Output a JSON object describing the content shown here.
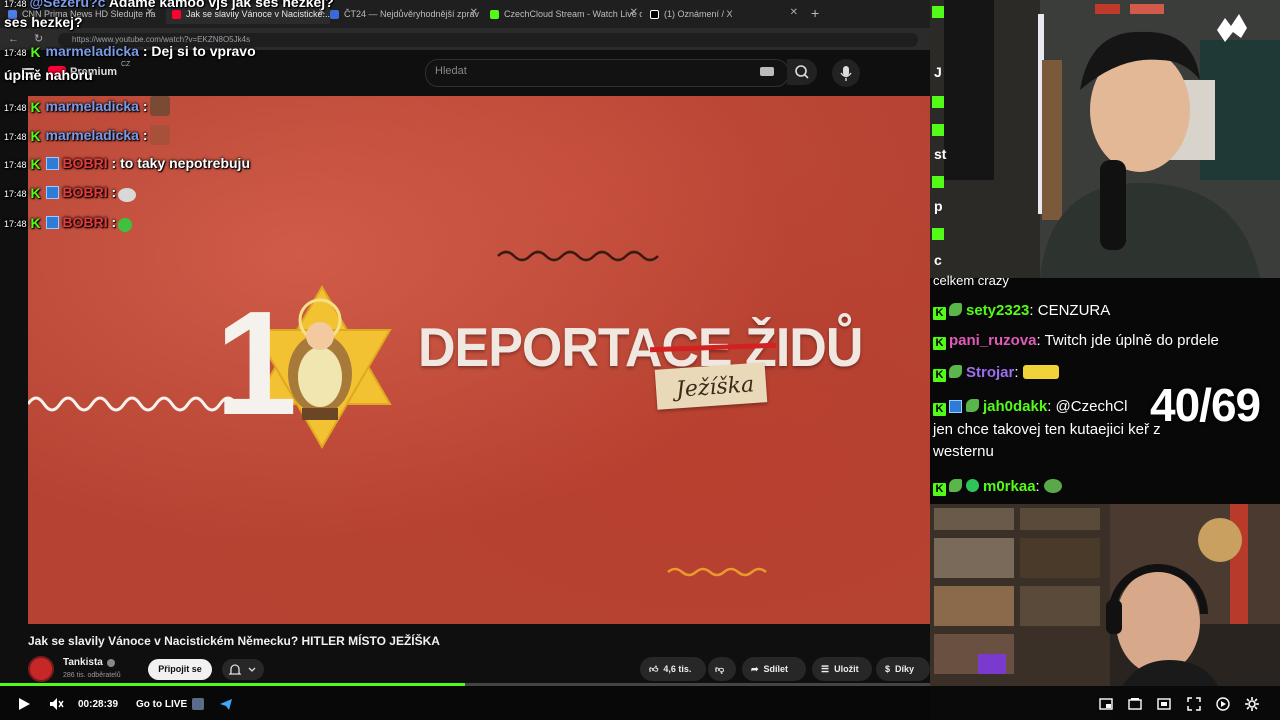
{
  "browser": {
    "tabs": [
      {
        "label": "CNN Prima News HD Sledujte na",
        "active": false,
        "color": "#4d7ee8"
      },
      {
        "label": "Jak se slavily Vánoce v Nacistické...",
        "active": true,
        "color": "#ff0033"
      },
      {
        "label": "ČT24 — Nejdůvěryhodnější zprav",
        "active": false,
        "color": "#3a6ad6"
      },
      {
        "label": "CzechCloud Stream - Watch Live o",
        "active": false,
        "color": "#53fc18"
      },
      {
        "label": "(1) Oznámení / X",
        "active": false,
        "color": "#ffffff"
      }
    ],
    "new_tab": "+",
    "url": "https://www.youtube.com/watch?v=EKZN8O5Jk4s"
  },
  "youtube": {
    "logo": "Premium",
    "logo_region": "CZ",
    "search_placeholder": "Hledat",
    "video": {
      "thumb_number": "1",
      "thumb_title": "DEPORTACE ŽIDŮ",
      "thumb_tag": "Ježíška",
      "title": "Jak se slavily Vánoce v Nacistickém Německu? HITLER MÍSTO JEŽÍŠKA"
    },
    "channel": {
      "name": "Tankista",
      "subscribers": "286 tis. odběratelů"
    },
    "subscribe_label": "Připojit se",
    "actions": {
      "likes": "4,6 tis.",
      "share": "Sdílet",
      "save": "Uložit",
      "thanks": "Díky"
    }
  },
  "left_chat": [
    {
      "time": "17:48",
      "user": "@Sezeru?c",
      "text": "Adame kamoo vjs jak ses hezkej?",
      "partial": true
    },
    {
      "time": "17:48",
      "user": "marmeladicka",
      "text": ": Dej si to vpravo",
      "wrap": "úplně nahoru",
      "badges": [
        "k"
      ]
    },
    {
      "time": "17:48",
      "user": "marmeladicka",
      "text": ":",
      "emote": "face",
      "badges": [
        "k"
      ]
    },
    {
      "time": "17:48",
      "user": "marmeladicka",
      "text": ":",
      "emote": "face2",
      "badges": [
        "k"
      ]
    },
    {
      "time": "17:48",
      "user": "BOBRI",
      "text": ": to taky nepotrebuju",
      "badges": [
        "k",
        "s"
      ]
    },
    {
      "time": "17:48",
      "user": "BOBRI",
      "text": ":",
      "emote": "troll",
      "badges": [
        "k",
        "s"
      ]
    },
    {
      "time": "17:48",
      "user": "BOBRI",
      "text": ":",
      "emote": "green",
      "badges": [
        "k",
        "s"
      ]
    }
  ],
  "right_chat": [
    {
      "user": "",
      "text": "celkem crazy"
    },
    {
      "user": "sety2323",
      "text": ": CENZURA",
      "color": "#53fc18"
    },
    {
      "user": "pani_ruzova",
      "text": ": Twitch jde úplně do prdele",
      "color": "#e05ab8"
    },
    {
      "user": "Strojar",
      "text": ":",
      "color": "#9b6ef0"
    },
    {
      "user": "jah0dakk",
      "text": ": @CzechCl",
      "wrap1": "jen chce takovej ten kutaejici keř z",
      "wrap2": "westernu",
      "color": "#53fc18"
    },
    {
      "user": "m0rkaa",
      "text": ":",
      "color": "#53fc18"
    }
  ],
  "counter": "40/69",
  "player": {
    "timecode": "00:28:39",
    "go_live": "Go to LIVE",
    "progress": 0.5,
    "accent": "#53fc18"
  },
  "right_chat_stubs": [
    "J",
    "st",
    "p",
    "c"
  ]
}
